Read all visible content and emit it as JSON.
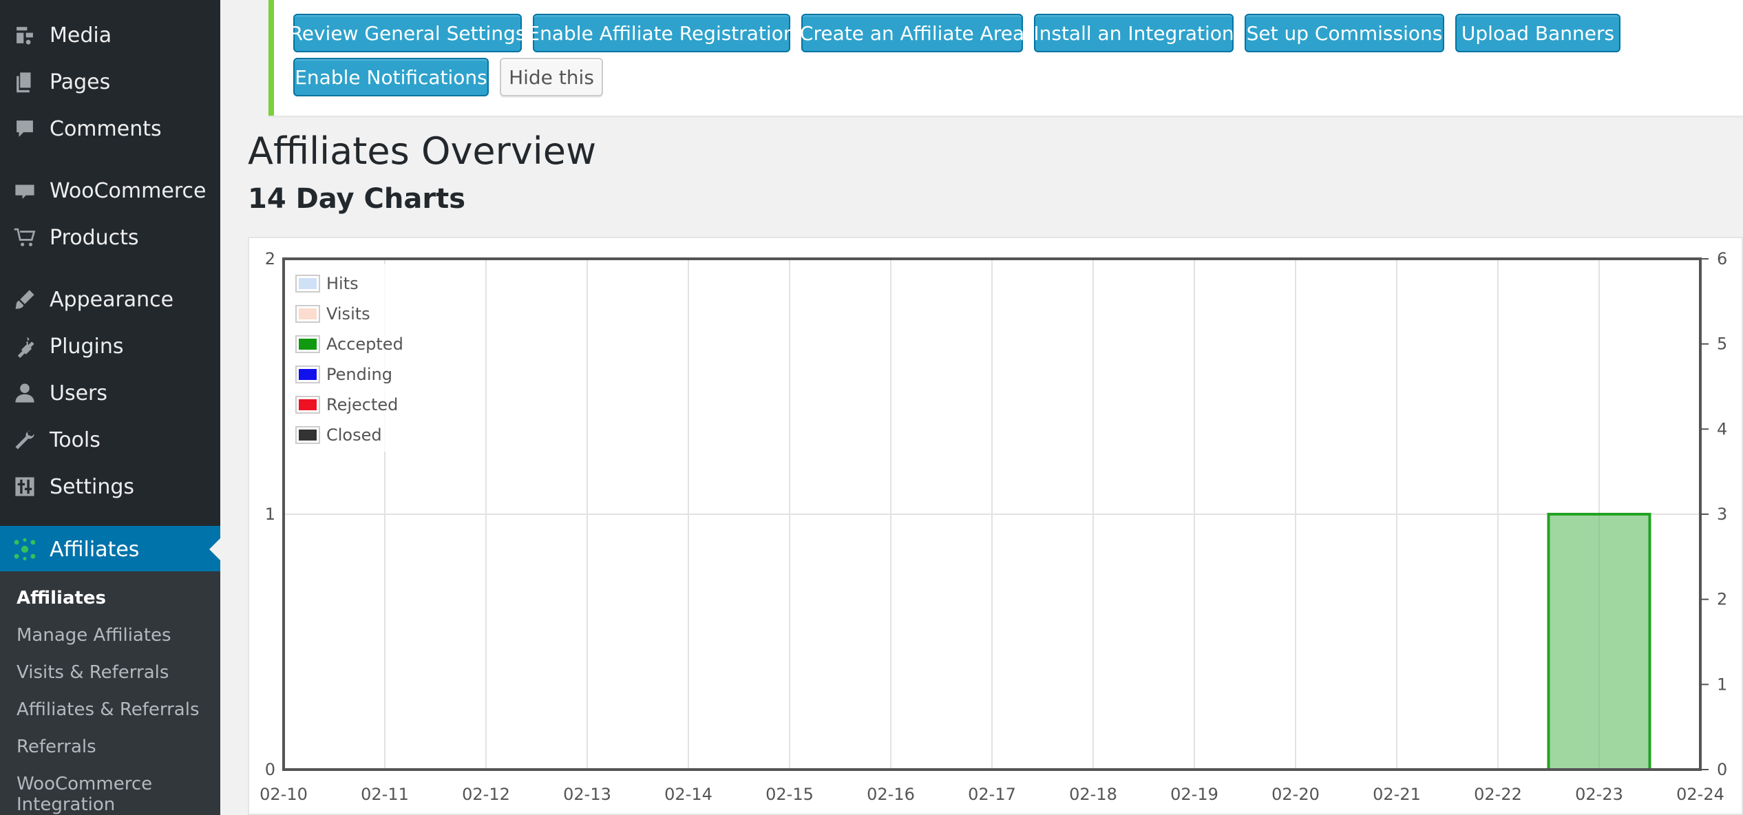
{
  "sidebar": {
    "items": [
      {
        "label": "Media",
        "icon": "media-icon"
      },
      {
        "label": "Pages",
        "icon": "pages-icon"
      },
      {
        "label": "Comments",
        "icon": "comments-icon"
      },
      {
        "label": "WooCommerce",
        "icon": "woocommerce-icon"
      },
      {
        "label": "Products",
        "icon": "cart-icon"
      },
      {
        "label": "Appearance",
        "icon": "brush-icon"
      },
      {
        "label": "Plugins",
        "icon": "plugin-icon"
      },
      {
        "label": "Users",
        "icon": "user-icon"
      },
      {
        "label": "Tools",
        "icon": "wrench-icon"
      },
      {
        "label": "Settings",
        "icon": "settings-sliders-icon"
      },
      {
        "label": "Affiliates",
        "icon": "affiliates-icon"
      }
    ],
    "submenu": [
      "Affiliates",
      "Manage Affiliates",
      "Visits & Referrals",
      "Affiliates & Referrals",
      "Referrals",
      "WooCommerce",
      "Integration"
    ]
  },
  "notice": {
    "buttons": [
      "Review General Settings",
      "Enable Affiliate Registration",
      "Create an Affiliate Area",
      "Install an Integration",
      "Set up Commissions",
      "Upload Banners",
      "Enable Notifications"
    ],
    "hide_label": "Hide this"
  },
  "page": {
    "title": "Affiliates Overview",
    "subtitle": "14 Day Charts"
  },
  "colors": {
    "accent": "#2ea2cc",
    "sidebar_bg": "#23282d",
    "active_menu": "#0073aa",
    "notice_border": "#7ad03a"
  },
  "chart_data": {
    "type": "bar",
    "x": [
      "02-10",
      "02-11",
      "02-12",
      "02-13",
      "02-14",
      "02-15",
      "02-16",
      "02-17",
      "02-18",
      "02-19",
      "02-20",
      "02-21",
      "02-22",
      "02-23",
      "02-24"
    ],
    "left_axis": {
      "ticks": [
        0,
        1,
        2
      ],
      "ylim": [
        0,
        2
      ]
    },
    "right_axis": {
      "ticks": [
        0,
        1,
        2,
        3,
        4,
        5,
        6
      ],
      "ylim": [
        0,
        6
      ]
    },
    "legend": [
      {
        "name": "Hits",
        "color": "#cfe0f7"
      },
      {
        "name": "Visits",
        "color": "#fbdcce"
      },
      {
        "name": "Accepted",
        "color": "#119911"
      },
      {
        "name": "Pending",
        "color": "#1111ee"
      },
      {
        "name": "Rejected",
        "color": "#ee1122"
      },
      {
        "name": "Closed",
        "color": "#333333"
      }
    ],
    "legend_position": "top-left",
    "grid": true,
    "bars": [
      {
        "series": "Accepted",
        "x": "02-23",
        "value": 1,
        "fill": "#a0d6a0",
        "stroke": "#22a322"
      }
    ]
  }
}
